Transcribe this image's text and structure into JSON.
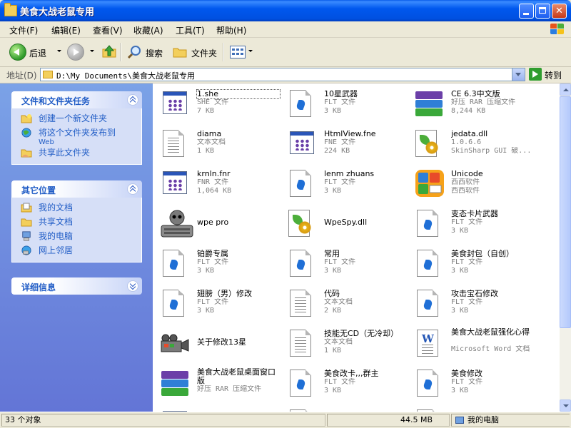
{
  "window": {
    "title": "美食大战老鼠专用"
  },
  "menu": [
    "文件(F)",
    "编辑(E)",
    "查看(V)",
    "收藏(A)",
    "工具(T)",
    "帮助(H)"
  ],
  "toolbar": {
    "back_label": "后退",
    "search_label": "搜索",
    "folders_label": "文件夹"
  },
  "address": {
    "label": "地址(D)",
    "path": "D:\\My Documents\\美食大战老鼠专用",
    "go_label": "转到"
  },
  "tasks": {
    "file_tasks": {
      "title": "文件和文件夹任务",
      "items": [
        {
          "label": "创建一个新文件夹"
        },
        {
          "label": "将这个文件夹发布到",
          "sub": "Web"
        },
        {
          "label": "共享此文件夹"
        }
      ]
    },
    "other_places": {
      "title": "其它位置",
      "items": [
        "我的文档",
        "共享文档",
        "我的电脑",
        "网上邻居"
      ]
    },
    "details": {
      "title": "详细信息"
    }
  },
  "files": [
    {
      "name": "1.she",
      "type": "SHE 文件",
      "size": "7 KB",
      "icon": "program-file-icon"
    },
    {
      "name": "10星武器",
      "type": "FLT 文件",
      "size": "3 KB",
      "icon": "flt-file-icon"
    },
    {
      "name": "CE 6.3中文版",
      "type": "好压 RAR 压缩文件",
      "size": "8,244 KB",
      "icon": "rar-archive-icon"
    },
    {
      "name": "diama",
      "type": "文本文档",
      "size": "1 KB",
      "icon": "text-file-icon"
    },
    {
      "name": "HtmlView.fne",
      "type": "FNE 文件",
      "size": "224 KB",
      "icon": "program-file-icon"
    },
    {
      "name": "jedata.dll",
      "type": "1.0.6.6",
      "size": "SkinSharp GUI 破...",
      "icon": "dll-file-icon"
    },
    {
      "name": "krnln.fnr",
      "type": "FNR 文件",
      "size": "1,064 KB",
      "icon": "program-file-icon"
    },
    {
      "name": "lenm zhuans",
      "type": "FLT 文件",
      "size": "3 KB",
      "icon": "flt-file-icon"
    },
    {
      "name": "Unicode",
      "type": "西西软件",
      "size": "西西软件",
      "icon": "unicode-app-icon"
    },
    {
      "name": "wpe pro",
      "type": "",
      "size": "",
      "icon": "wpe-app-icon"
    },
    {
      "name": "WpeSpy.dll",
      "type": "",
      "size": "",
      "icon": "dll-file-icon"
    },
    {
      "name": "变态卡片武器",
      "type": "FLT 文件",
      "size": "3 KB",
      "icon": "flt-file-icon"
    },
    {
      "name": "铂爵专属",
      "type": "FLT 文件",
      "size": "3 KB",
      "icon": "flt-file-icon"
    },
    {
      "name": "常用",
      "type": "FLT 文件",
      "size": "3 KB",
      "icon": "flt-file-icon"
    },
    {
      "name": "美食封包（自创）",
      "type": "FLT 文件",
      "size": "3 KB",
      "icon": "flt-file-icon"
    },
    {
      "name": "翅膀（男）修改",
      "type": "FLT 文件",
      "size": "3 KB",
      "icon": "flt-file-icon"
    },
    {
      "name": "代码",
      "type": "文本文档",
      "size": "2 KB",
      "icon": "text-file-icon"
    },
    {
      "name": "攻击宝石修改",
      "type": "FLT 文件",
      "size": "3 KB",
      "icon": "flt-file-icon"
    },
    {
      "name": "关于修改13星",
      "type": "",
      "size": "",
      "icon": "video-camera-icon"
    },
    {
      "name": "技能无CD（无冷却）",
      "type": "文本文档",
      "size": "1 KB",
      "icon": "text-file-icon"
    },
    {
      "name": "美食大战老鼠强化心得",
      "type": "Microsoft Word 文档",
      "size": "",
      "icon": "word-doc-icon"
    },
    {
      "name": "美食大战老鼠桌面窗口版",
      "type": "好压 RAR 压缩文件",
      "size": "",
      "icon": "rar-archive-icon"
    },
    {
      "name": "美食改卡,,,群主",
      "type": "FLT 文件",
      "size": "3 KB",
      "icon": "flt-file-icon"
    },
    {
      "name": "美食修改",
      "type": "FLT 文件",
      "size": "3 KB",
      "icon": "flt-file-icon"
    }
  ],
  "status": {
    "count": "33 个对象",
    "size": "44.5 MB",
    "location": "我的电脑"
  }
}
